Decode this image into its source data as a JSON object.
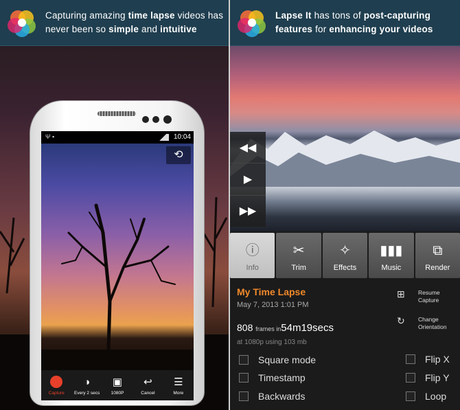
{
  "left_banner": {
    "part1": "Capturing amazing ",
    "bold1": "time lapse",
    "part2": " videos has never been so ",
    "bold2": "simple",
    "part3": " and ",
    "bold3": "intuitive"
  },
  "right_banner": {
    "bold1": "Lapse It",
    "part1": " has tons of ",
    "bold2": "post-capturing features",
    "part2": " for ",
    "bold3": "enhancing your videos"
  },
  "phone": {
    "time": "10:04",
    "toolbar": [
      {
        "label": "Capture"
      },
      {
        "label": "Every 2 secs"
      },
      {
        "label": "1080P"
      },
      {
        "label": "Cancel"
      },
      {
        "label": "More"
      }
    ]
  },
  "tabs": [
    {
      "label": "Info",
      "icon": "info-icon"
    },
    {
      "label": "Trim",
      "icon": "scissors-icon"
    },
    {
      "label": "Effects",
      "icon": "effects-icon"
    },
    {
      "label": "Music",
      "icon": "music-icon"
    },
    {
      "label": "Render",
      "icon": "render-icon"
    }
  ],
  "info": {
    "title": "My Time Lapse",
    "date": "May 7, 2013 1:01 PM",
    "frames_count": "808",
    "frames_word": "frames in",
    "duration": "54m19secs",
    "resolution": "at 1080p using 103 mb",
    "resume_capture": "Resume Capture",
    "change_orientation": "Change Orientation"
  },
  "options": {
    "square_mode": "Square mode",
    "timestamp": "Timestamp",
    "backwards": "Backwards",
    "flip_x": "Flip X",
    "flip_y": "Flip Y",
    "loop": "Loop"
  },
  "colors": {
    "banner": "#1f3e4f",
    "accent_orange": "#f1892b",
    "record_red": "#e8402a"
  }
}
